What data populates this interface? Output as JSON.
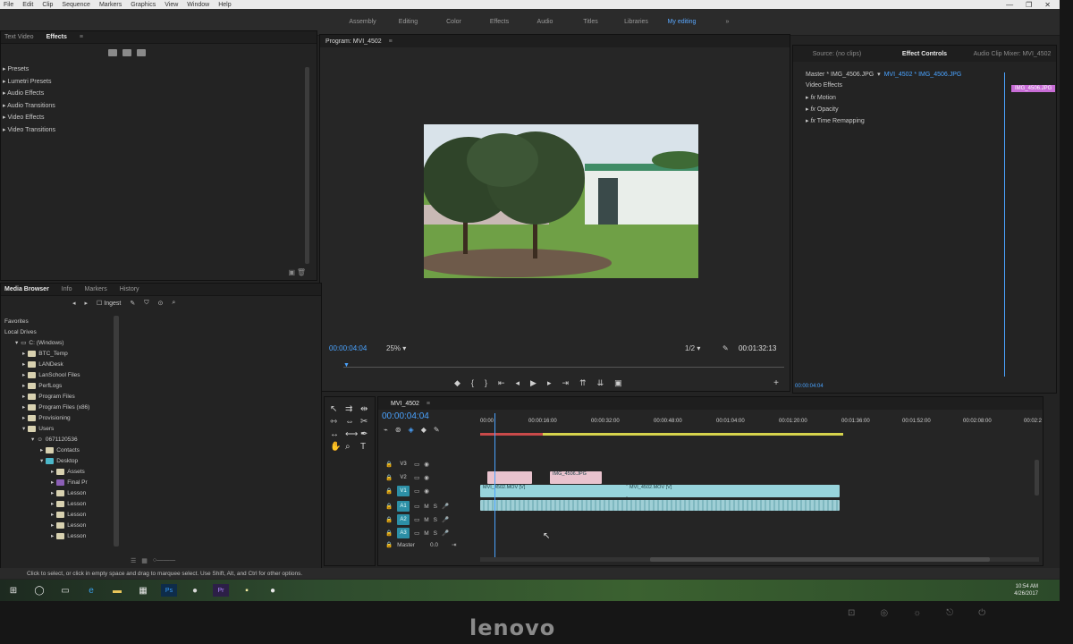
{
  "menubar": {
    "items": [
      "File",
      "Edit",
      "Clip",
      "Sequence",
      "Markers",
      "Graphics",
      "View",
      "Window",
      "Help"
    ],
    "window_controls": [
      "—",
      "❐",
      "✕"
    ]
  },
  "workspaces": [
    "Assembly",
    "Editing",
    "Color",
    "Effects",
    "Audio",
    "Titles",
    "Libraries",
    "My editing",
    "»"
  ],
  "effects_panel": {
    "tabs": [
      "Text Video",
      "Effects"
    ],
    "items": [
      "Presets",
      "Lumetri Presets",
      "Audio Effects",
      "Audio Transitions",
      "Video Effects",
      "Video Transitions"
    ]
  },
  "program_monitor": {
    "title": "Program: MVI_4502",
    "timecode_current": "00:00:04:04",
    "zoom": "25%",
    "quality": "1/2",
    "timecode_duration": "00:01:32:13"
  },
  "effect_controls": {
    "tabs": [
      "Source: (no clips)",
      "Effect Controls",
      "Audio Clip Mixer: MVI_4502"
    ],
    "master_label": "Master * IMG_4506.JPG",
    "sequence_clip": "MVI_4502 * IMG_4506.JPG",
    "clip_badge": "IMG_4506.JPG",
    "section": "Video Effects",
    "effects": [
      "Motion",
      "Opacity",
      "Time Remapping"
    ],
    "timecode": "00:00:04:04"
  },
  "media_browser": {
    "tabs": [
      "Media Browser",
      "Info",
      "Markers",
      "History"
    ],
    "ingest": "Ingest",
    "tree": [
      "Favorites",
      "Local Drives",
      "C: (Windows)",
      "BTC_Temp",
      "LANDesk",
      "LanSchool Files",
      "PerfLogs",
      "Program Files",
      "Program Files (x86)",
      "Provisioning",
      "Users",
      "0671120536",
      "Contacts",
      "Desktop",
      "Assets",
      "Final Pr",
      "Lesson",
      "Lesson",
      "Lesson",
      "Lesson",
      "Lesson"
    ]
  },
  "timeline": {
    "sequence": "MVI_4502",
    "timecode": "00:00:04:04",
    "ruler": [
      "00:00",
      "00:00:16:00",
      "00:00:32:00",
      "00:00:48:00",
      "00:01:04:00",
      "00:01:20:00",
      "00:01:36:00",
      "00:01:52:00",
      "00:02:08:00",
      "00:02:2"
    ],
    "tracks": [
      "V3",
      "V2",
      "V1",
      "A1",
      "A2",
      "A3"
    ],
    "master": "Master",
    "master_value": "0.0",
    "clip_v1_a": "MVI_4502.MOV [V]",
    "clip_v1_b": "MVI_4502.MOV [V]",
    "clip_v2_b": "IMG_4506.JPG"
  },
  "statusbar": "Click to select, or click in empty space and drag to marquee select. Use Shift, Alt, and Ctrl for other options.",
  "taskbar": {
    "time": "10:54 AM",
    "date": "4/26/2017"
  },
  "bezel": {
    "brand": "lenovo"
  }
}
